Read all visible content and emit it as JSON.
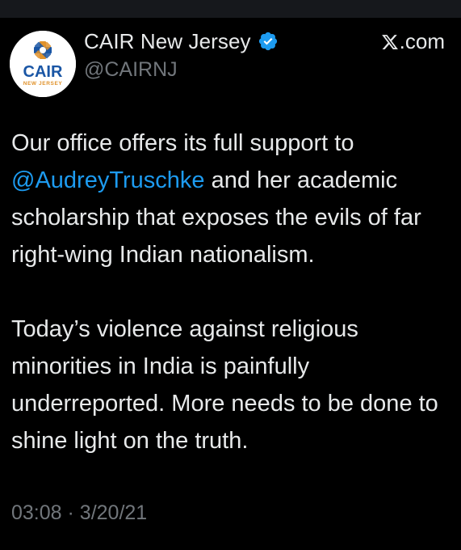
{
  "tweet": {
    "author": {
      "display_name": "CAIR New Jersey",
      "handle": "@CAIRNJ",
      "verified": true,
      "avatar_text": "CAIR",
      "avatar_subtext": "NEW JERSEY"
    },
    "source_label": ".com",
    "source_icon": "x-logo-icon",
    "body": {
      "para1_before": "Our office offers its full support to ",
      "mention": "@AudreyTruschke",
      "para1_after": " and her academic scholarship that exposes the evils of far right-wing Indian nationalism.",
      "para2": "Today’s violence against religious minorities in India is painfully underreported. More needs to be done to shine light on the truth."
    },
    "time": "03:08",
    "separator": "·",
    "date": "3/20/21"
  },
  "colors": {
    "background": "#000000",
    "text": "#e7e9ea",
    "muted": "#71767b",
    "link": "#1d9bf0",
    "verified": "#1d9bf0",
    "cair_blue": "#1a56a5",
    "cair_orange": "#e0922b"
  }
}
